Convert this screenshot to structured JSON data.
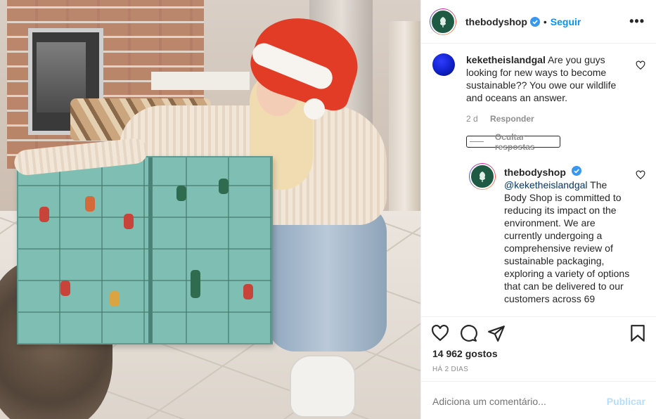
{
  "post": {
    "author": {
      "username": "thebodyshop",
      "verified": true,
      "follow_label": "Seguir",
      "more_label": "•••",
      "brand_color": "#1f5a45"
    },
    "comments": [
      {
        "username": "keketheislandgal",
        "text": "Are you guys looking for new ways to become sustainable?? You owe our wildlife and oceans an answer.",
        "time": "2 d",
        "reply_label": "Responder",
        "hide_replies_label": "Ocultar respostas",
        "replies": [
          {
            "username": "thebodyshop",
            "mention": "@keketheislandgal",
            "text": "The Body Shop is committed to reducing its impact on the environment. We are currently undergoing a comprehensive review of sustainable packaging, exploring a variety of options that can be delivered to our customers across 69"
          }
        ]
      }
    ],
    "likes_text": "14 962 gostos",
    "date_text": "HÁ 2 DIAS",
    "add_comment_placeholder": "Adiciona um comentário...",
    "publish_label": "Publicar",
    "colors": {
      "link_blue": "#0095f6",
      "publish_disabled": "#b2dffc",
      "muted": "#8e8e8e"
    }
  }
}
